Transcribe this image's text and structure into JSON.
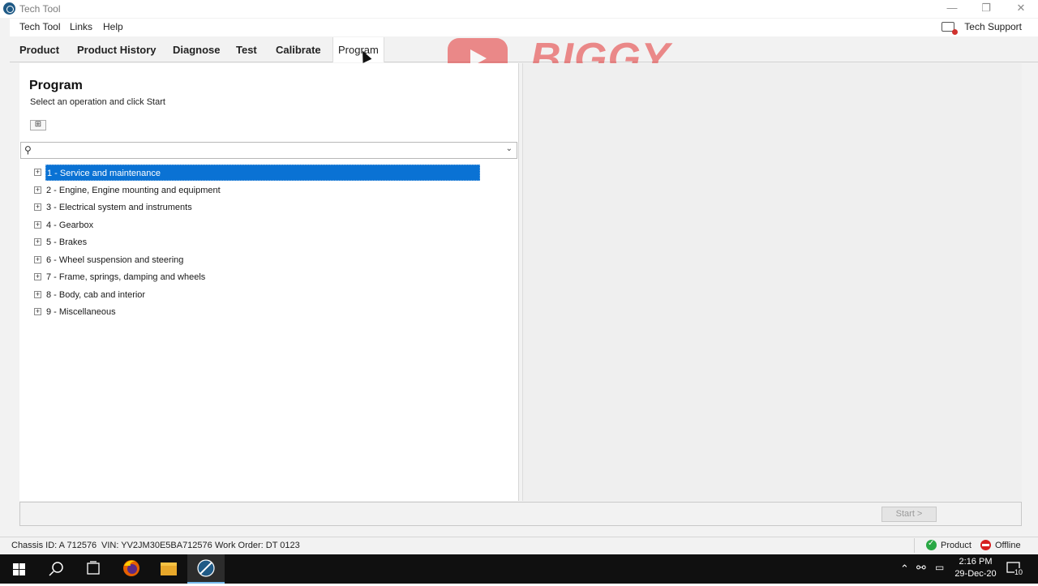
{
  "window": {
    "title": "Tech Tool"
  },
  "menubar": {
    "items": [
      {
        "label": "Tech Tool"
      },
      {
        "label": "Links"
      },
      {
        "label": "Help"
      }
    ],
    "tech_support": "Tech Support"
  },
  "tabs": [
    {
      "label": "Product",
      "active": false
    },
    {
      "label": "Product History",
      "active": false
    },
    {
      "label": "Diagnose",
      "active": false
    },
    {
      "label": "Test",
      "active": false
    },
    {
      "label": "Calibrate",
      "active": false
    },
    {
      "label": "Program",
      "active": true
    }
  ],
  "program": {
    "title": "Program",
    "subtitle": "Select an operation and click Start",
    "search": {
      "value": "",
      "placeholder": ""
    },
    "tree": [
      {
        "label": "1 - Service and maintenance",
        "selected": true
      },
      {
        "label": "2 - Engine, Engine mounting and equipment",
        "selected": false
      },
      {
        "label": "3 - Electrical system and instruments",
        "selected": false
      },
      {
        "label": "4 - Gearbox",
        "selected": false
      },
      {
        "label": "5 - Brakes",
        "selected": false
      },
      {
        "label": "6 - Wheel suspension and steering",
        "selected": false
      },
      {
        "label": "7 - Frame, springs, damping and wheels",
        "selected": false
      },
      {
        "label": "8 - Body, cab and interior",
        "selected": false
      },
      {
        "label": "9 - Miscellaneous",
        "selected": false
      }
    ]
  },
  "actions": {
    "start_label": "Start >"
  },
  "statusbar": {
    "chassis": "Chassis ID: A 712576",
    "vin": "VIN: YV2JM30E5BA712576",
    "work_order": "Work Order: DT 0123",
    "product_status": "Product",
    "connection_status": "Offline"
  },
  "taskbar": {
    "time": "2:16 PM",
    "date": "29-Dec-20",
    "notifications": "10"
  },
  "watermark": {
    "text": "BIGGY FERI"
  },
  "colors": {
    "selection": "#0a72d4",
    "status_ok": "#2aa845",
    "status_offline": "#d62020",
    "watermark": "#e32020"
  }
}
